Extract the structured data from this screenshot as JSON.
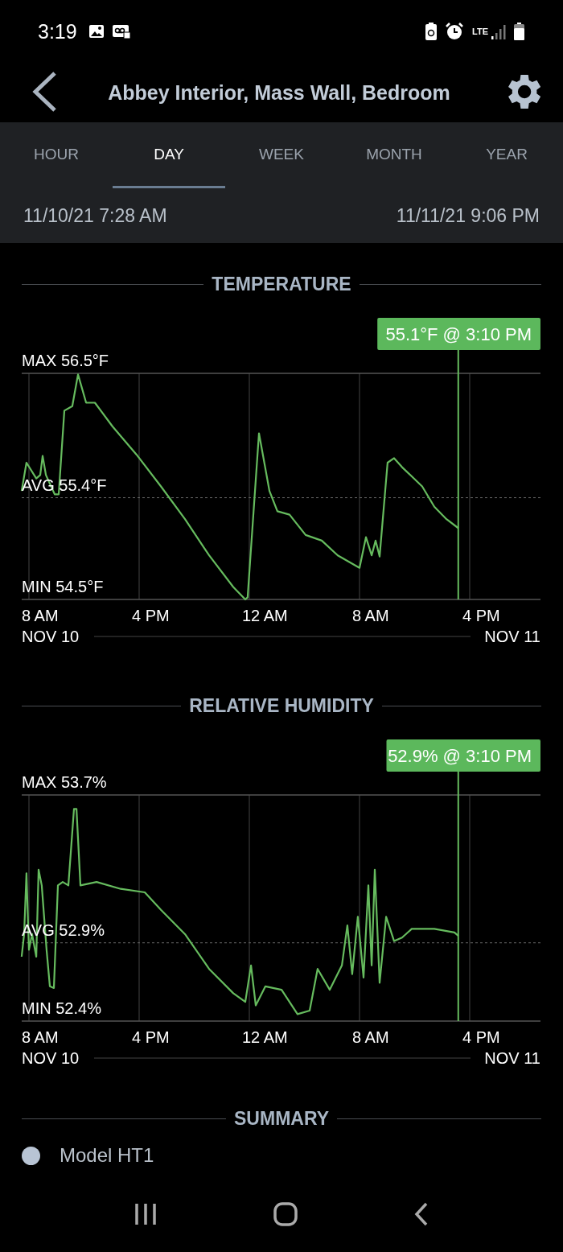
{
  "status_bar": {
    "time": "3:19",
    "network": "LTE"
  },
  "header": {
    "title": "Abbey Interior, Mass Wall, Bedroom"
  },
  "tabs": [
    {
      "label": "HOUR",
      "selected": false
    },
    {
      "label": "DAY",
      "selected": true
    },
    {
      "label": "WEEK",
      "selected": false
    },
    {
      "label": "MONTH",
      "selected": false
    },
    {
      "label": "YEAR",
      "selected": false
    }
  ],
  "range": {
    "start": "11/10/21 7:28 AM",
    "end": "11/11/21 9:06 PM"
  },
  "charts": [
    {
      "title": "TEMPERATURE",
      "reading": "55.1°F @ 3:10 PM",
      "max_label": "MAX 56.5°F",
      "avg_label": "AVG 55.4°F",
      "min_label": "MIN 54.5°F",
      "time_labels": [
        "8 AM",
        "4 PM",
        "12 AM",
        "8 AM",
        "4 PM"
      ],
      "date_labels": [
        "NOV 10",
        "NOV 11"
      ]
    },
    {
      "title": "RELATIVE HUMIDITY",
      "reading": "52.9% @ 3:10 PM",
      "max_label": "MAX 53.7%",
      "avg_label": "AVG 52.9%",
      "min_label": "MIN 52.4%",
      "time_labels": [
        "8 AM",
        "4 PM",
        "12 AM",
        "8 AM",
        "4 PM"
      ],
      "date_labels": [
        "NOV 10",
        "NOV 11"
      ]
    }
  ],
  "summary": {
    "title": "SUMMARY",
    "items": [
      {
        "label": "Model HT1"
      }
    ]
  }
}
